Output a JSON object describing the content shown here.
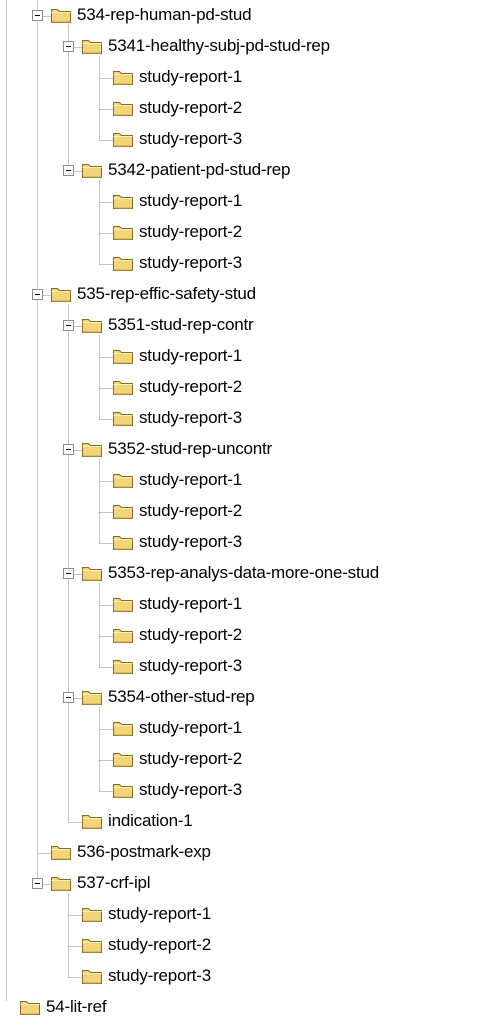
{
  "tree": {
    "nodes": [
      {
        "label": "534-rep-human-pd-stud",
        "depth": 1,
        "expanded": true,
        "icon": "folder-icon"
      },
      {
        "label": "5341-healthy-subj-pd-stud-rep",
        "depth": 2,
        "expanded": true,
        "icon": "folder-icon"
      },
      {
        "label": "study-report-1",
        "depth": 3,
        "icon": "folder-icon"
      },
      {
        "label": "study-report-2",
        "depth": 3,
        "icon": "folder-icon"
      },
      {
        "label": "study-report-3",
        "depth": 3,
        "icon": "folder-icon"
      },
      {
        "label": "5342-patient-pd-stud-rep",
        "depth": 2,
        "expanded": true,
        "icon": "folder-icon"
      },
      {
        "label": "study-report-1",
        "depth": 3,
        "icon": "folder-icon"
      },
      {
        "label": "study-report-2",
        "depth": 3,
        "icon": "folder-icon"
      },
      {
        "label": "study-report-3",
        "depth": 3,
        "icon": "folder-icon"
      },
      {
        "label": "535-rep-effic-safety-stud",
        "depth": 1,
        "expanded": true,
        "icon": "folder-icon"
      },
      {
        "label": "5351-stud-rep-contr",
        "depth": 2,
        "expanded": true,
        "icon": "folder-icon"
      },
      {
        "label": "study-report-1",
        "depth": 3,
        "icon": "folder-icon"
      },
      {
        "label": "study-report-2",
        "depth": 3,
        "icon": "folder-icon"
      },
      {
        "label": "study-report-3",
        "depth": 3,
        "icon": "folder-icon"
      },
      {
        "label": "5352-stud-rep-uncontr",
        "depth": 2,
        "expanded": true,
        "icon": "folder-icon"
      },
      {
        "label": "study-report-1",
        "depth": 3,
        "icon": "folder-icon"
      },
      {
        "label": "study-report-2",
        "depth": 3,
        "icon": "folder-icon"
      },
      {
        "label": "study-report-3",
        "depth": 3,
        "icon": "folder-icon"
      },
      {
        "label": "5353-rep-analys-data-more-one-stud",
        "depth": 2,
        "expanded": true,
        "icon": "folder-icon"
      },
      {
        "label": "study-report-1",
        "depth": 3,
        "icon": "folder-icon"
      },
      {
        "label": "study-report-2",
        "depth": 3,
        "icon": "folder-icon"
      },
      {
        "label": "study-report-3",
        "depth": 3,
        "icon": "folder-icon"
      },
      {
        "label": "5354-other-stud-rep",
        "depth": 2,
        "expanded": true,
        "icon": "folder-icon"
      },
      {
        "label": "study-report-1",
        "depth": 3,
        "icon": "folder-icon"
      },
      {
        "label": "study-report-2",
        "depth": 3,
        "icon": "folder-icon"
      },
      {
        "label": "study-report-3",
        "depth": 3,
        "icon": "folder-icon"
      },
      {
        "label": "indication-1",
        "depth": 2,
        "icon": "folder-icon"
      },
      {
        "label": "536-postmark-exp",
        "depth": 1,
        "icon": "folder-icon"
      },
      {
        "label": "537-crf-ipl",
        "depth": 1,
        "expanded": true,
        "icon": "folder-icon"
      },
      {
        "label": "study-report-1",
        "depth": 2,
        "icon": "folder-icon"
      },
      {
        "label": "study-report-2",
        "depth": 2,
        "icon": "folder-icon"
      },
      {
        "label": "study-report-3",
        "depth": 2,
        "icon": "folder-icon"
      },
      {
        "label": "54-lit-ref",
        "depth": 0,
        "icon": "folder-icon"
      }
    ]
  },
  "colors": {
    "folder_fill": "#f2d47a",
    "folder_stroke": "#8a6a1e",
    "connector_line": "#8c8c8c",
    "text": "#000000",
    "background": "#ffffff"
  }
}
